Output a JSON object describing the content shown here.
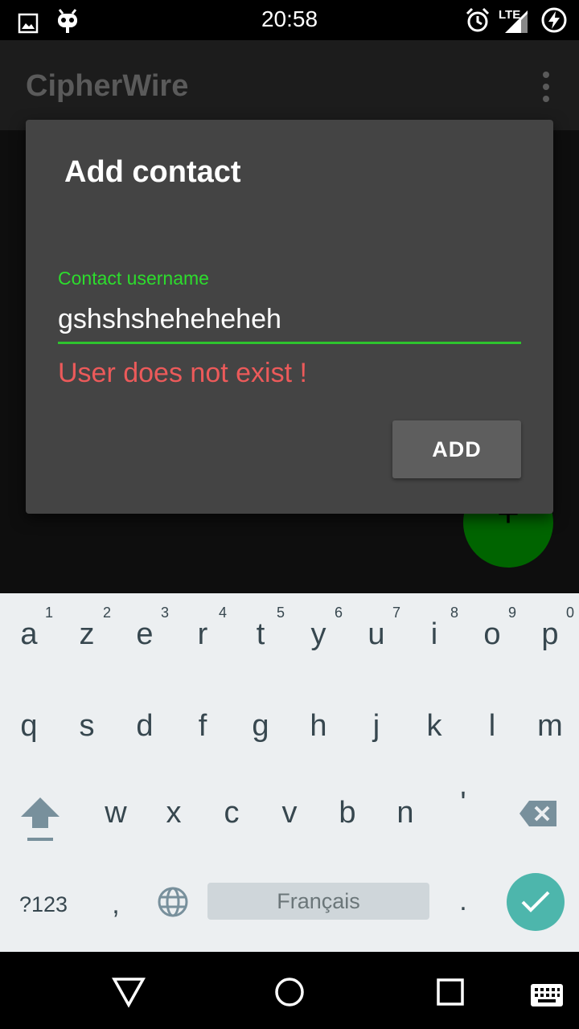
{
  "status_bar": {
    "time": "20:58",
    "network": "LTE",
    "icons": [
      "image-icon",
      "android-debug-icon",
      "alarm-icon",
      "signal-icon",
      "battery-charging-icon"
    ]
  },
  "app_bar": {
    "title": "CipherWire",
    "overflow_icon": "more-vert-icon"
  },
  "fab": {
    "label": "+"
  },
  "dialog": {
    "title": "Add contact",
    "field_label": "Contact username",
    "field_value": "gshshsheheheheh",
    "error": "User does not exist !",
    "add_button": "ADD"
  },
  "keyboard": {
    "row1": [
      {
        "key": "a",
        "hint": "1"
      },
      {
        "key": "z",
        "hint": "2"
      },
      {
        "key": "e",
        "hint": "3"
      },
      {
        "key": "r",
        "hint": "4"
      },
      {
        "key": "t",
        "hint": "5"
      },
      {
        "key": "y",
        "hint": "6"
      },
      {
        "key": "u",
        "hint": "7"
      },
      {
        "key": "i",
        "hint": "8"
      },
      {
        "key": "o",
        "hint": "9"
      },
      {
        "key": "p",
        "hint": "0"
      }
    ],
    "row2": [
      "q",
      "s",
      "d",
      "f",
      "g",
      "h",
      "j",
      "k",
      "l",
      "m"
    ],
    "row3": [
      "w",
      "x",
      "c",
      "v",
      "b",
      "n",
      "'"
    ],
    "symbols_key": "?123",
    "comma_key": ",",
    "period_key": ".",
    "space_label": "Français"
  },
  "colors": {
    "accent_green": "#2ddc2d",
    "error_red": "#ec5a5a",
    "fab_green": "#006400",
    "done_teal": "#4db6ac"
  }
}
